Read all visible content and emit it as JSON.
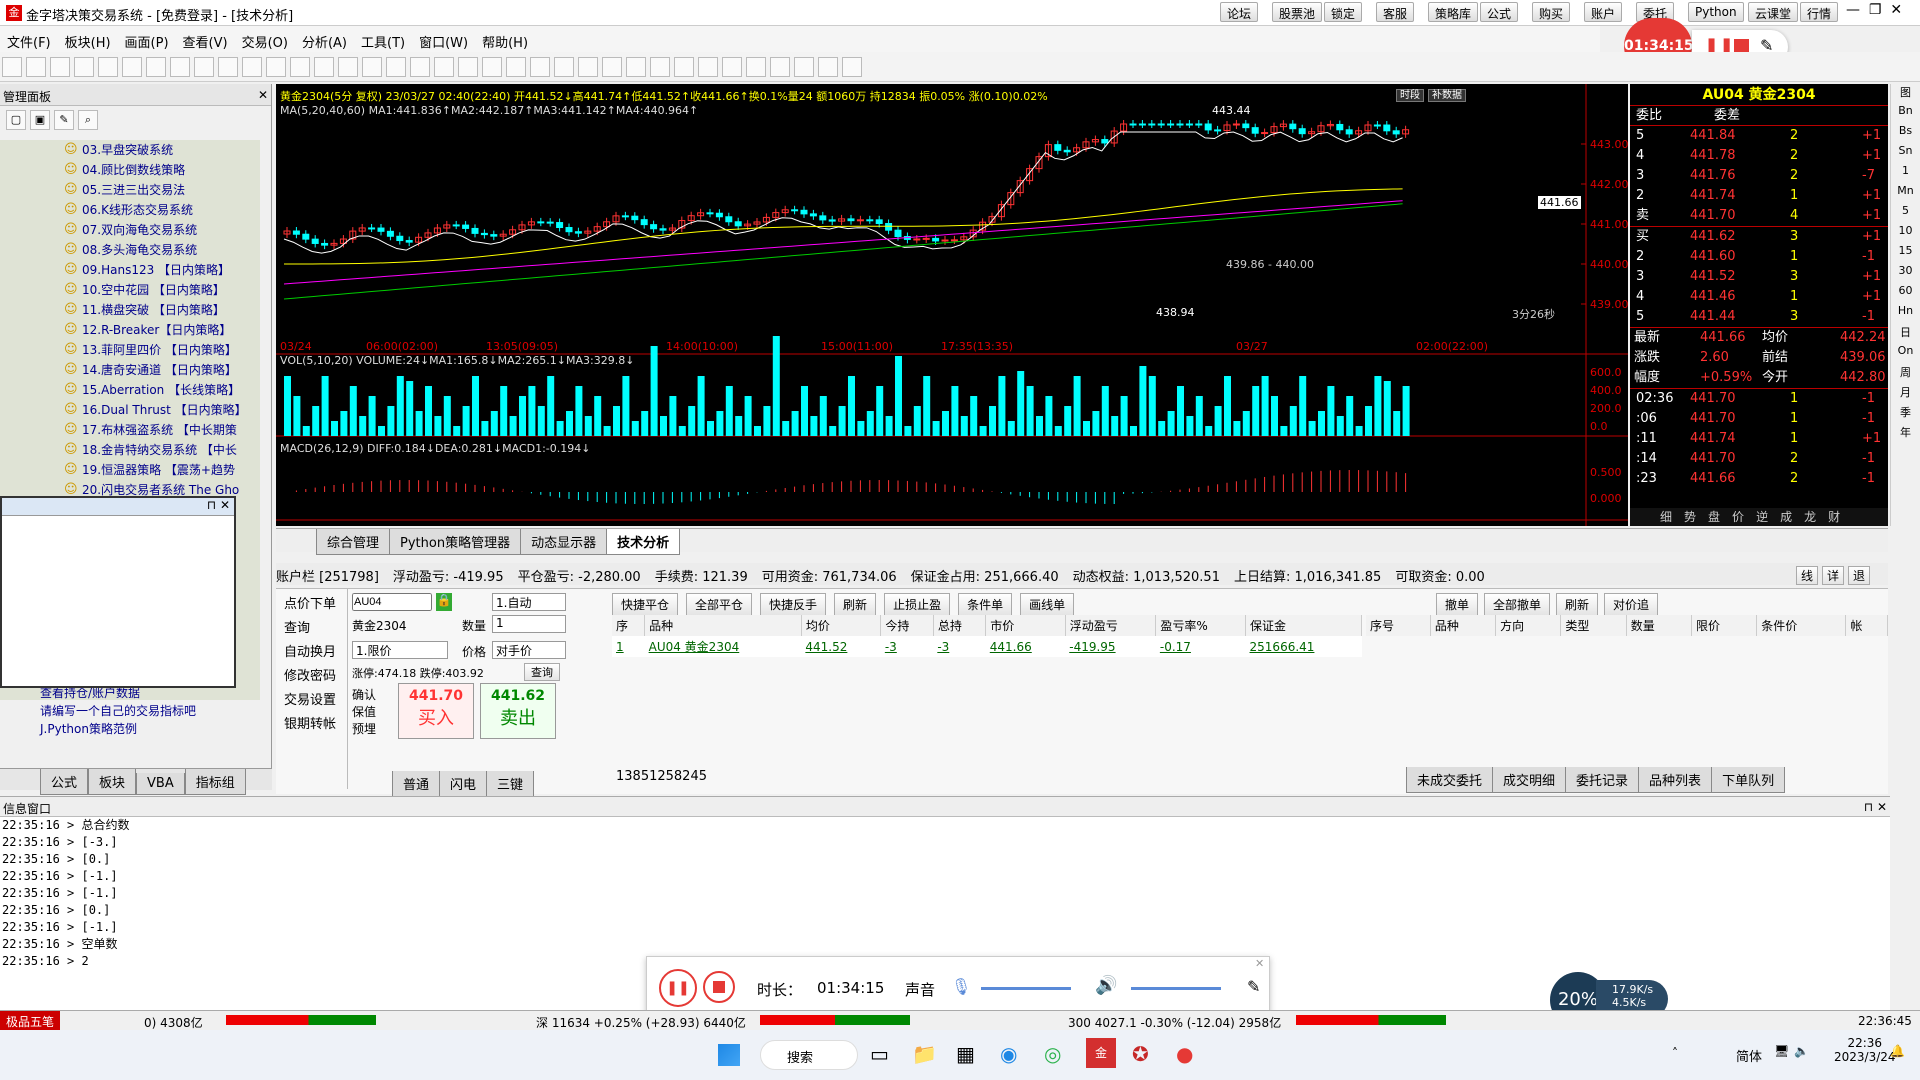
{
  "window": {
    "title": "金字塔决策交易系统 - [免费登录] - [技术分析]",
    "top_buttons": [
      "论坛",
      "股票池",
      "锁定",
      "客服",
      "策略库",
      "公式",
      "购买",
      "账户",
      "委托",
      "Python",
      "云课堂",
      "行情"
    ]
  },
  "menu": [
    "文件(F)",
    "板块(H)",
    "画面(P)",
    "查看(V)",
    "交易(O)",
    "分析(A)",
    "工具(T)",
    "窗口(W)",
    "帮助(H)"
  ],
  "recorder_badge": "01:34:15",
  "left_panel": {
    "title": "管理面板",
    "items": [
      "03.早盘突破系统",
      "04.顾比倒数线策略",
      "05.三进三出交易法",
      "06.K线形态交易系统",
      "07.双向海龟交易系统",
      "08.多头海龟交易系统",
      "09.Hans123 【日内策略】",
      "10.空中花园 【日内策略】",
      "11.横盘突破 【日内策略】",
      "12.R-Breaker【日内策略】",
      "13.菲阿里四价 【日内策略】",
      "14.唐奇安通道 【日内策略】",
      "15.Aberration 【长线策略】",
      "16.Dual Thrust 【日内策略】",
      "17.布林强盗系统 【中长期策",
      "18.金肯特纳交易系统 【中长",
      "19.恒温器策略 【震荡+趋势",
      "20.闪电交易者系统 The Gho"
    ],
    "extra_items": [
      "查看持仓/账户数据",
      "请编写一个自己的交易指标吧",
      "J.Python策略范例"
    ],
    "tabs": [
      "公式",
      "板块",
      "VBA",
      "指标组"
    ]
  },
  "chart": {
    "header": "黄金2304(5分 复权) 23/03/27 02:40(22:40) 开441.52↓高441.74↑低441.52↑收441.66↑换0.1%量24 额1060万 持12834 振0.05% 涨(0.10)0.02%",
    "ma": "MA(5,20,40,60) MA1:441.836↑MA2:442.187↑MA3:441.142↑MA4:440.964↑",
    "vol": "VOL(5,10,20) VOLUME:24↓MA1:165.8↓MA2:265.1↓MA3:329.8↓",
    "macd": "MACD(26,12,9) DIFF:0.184↓DEA:0.281↓MACD1:-0.194↓",
    "yticks": [
      "443.00",
      "442.00",
      "441.00",
      "440.00",
      "439.00"
    ],
    "time_labels": [
      "03/24",
      "06:00(02:00)",
      "13:05(09:05)",
      "14:00(10:00)",
      "15:00(11:00)",
      "17:35(13:35)",
      "03/27",
      "02:00(22:00)"
    ],
    "high_label": "443.44",
    "low_label": "438.94",
    "range_label": "439.86 - 440.00",
    "countdown": "3分26秒",
    "price_tag": "441.66",
    "vol_ticks": [
      "600.0",
      "400.0",
      "200.0",
      "0.0"
    ],
    "macd_ticks": [
      "0.500",
      "0.000"
    ],
    "tags": [
      "时段",
      "补数据"
    ]
  },
  "quote": {
    "title": "AU04 黄金2304",
    "head": [
      "委比",
      "委差"
    ],
    "sells": [
      [
        "5",
        "441.84",
        "2",
        "+1"
      ],
      [
        "4",
        "441.78",
        "2",
        "+1"
      ],
      [
        "3",
        "441.76",
        "2",
        "-7"
      ],
      [
        "2",
        "441.74",
        "1",
        "+1"
      ],
      [
        "卖",
        "441.70",
        "4",
        "+1"
      ]
    ],
    "buys": [
      [
        "买",
        "441.62",
        "3",
        "+1"
      ],
      [
        "2",
        "441.60",
        "1",
        "-1"
      ],
      [
        "3",
        "441.52",
        "3",
        "+1"
      ],
      [
        "4",
        "441.46",
        "1",
        "+1"
      ],
      [
        "5",
        "441.44",
        "3",
        "-1"
      ]
    ],
    "stats": [
      [
        "最新",
        "441.66",
        "均价",
        "442.24"
      ],
      [
        "涨跌",
        "2.60",
        "前结",
        "439.06"
      ],
      [
        "幅度",
        "+0.59%",
        "今开",
        "442.80"
      ]
    ],
    "ticks": [
      [
        "02:36",
        "441.70",
        "1",
        "-1"
      ],
      [
        ":06",
        "441.70",
        "1",
        "-1"
      ],
      [
        ":11",
        "441.74",
        "1",
        "+1"
      ],
      [
        ":14",
        "441.70",
        "2",
        "-1"
      ],
      [
        ":23",
        "441.66",
        "2",
        "-1"
      ]
    ],
    "bottom_tabs": [
      "细",
      "势",
      "盘",
      "价",
      "逆",
      "成",
      "龙",
      "财"
    ]
  },
  "right_bar": [
    "图",
    "Bn",
    "Bs",
    "Sn",
    "1",
    "Mn",
    "5",
    "10",
    "15",
    "30",
    "60",
    "Hn",
    "日",
    "On",
    "周",
    "月",
    "季",
    "年"
  ],
  "main_tabs": [
    "综合管理",
    "Python策略管理器",
    "动态显示器",
    "技术分析"
  ],
  "account": {
    "items": [
      "账户栏 [251798]",
      "浮动盈亏: -419.95",
      "平仓盈亏: -2,280.00",
      "手续费: 121.39",
      "可用资金: 761,734.06",
      "保证金占用: 251,666.40",
      "动态权益: 1,013,520.51",
      "上日结算: 1,016,341.85",
      "可取资金: 0.00"
    ],
    "tail": [
      "线",
      "详",
      "退"
    ]
  },
  "order_menu": [
    "点价下单",
    "查询",
    "自动换月",
    "修改密码",
    "交易设置",
    "银期转帐"
  ],
  "order_form": {
    "code": "AU04",
    "name": "黄金2304",
    "mode": "1.自动",
    "qty_label": "数量",
    "qty": "1",
    "type": "1.限价",
    "price_label": "价格",
    "price": "对手价",
    "limits": "涨停:474.18 跌停:403.92",
    "query": "查询",
    "checks": [
      "确认",
      "保值",
      "预埋"
    ],
    "buy_price": "441.70",
    "buy": "买入",
    "sell_price": "441.62",
    "sell": "卖出",
    "tabs": [
      "普通",
      "闪电",
      "三键"
    ]
  },
  "pos_buttons": [
    "快捷平仓",
    "全部平仓",
    "快捷反手",
    "刷新",
    "止损止盈",
    "条件单",
    "画线单"
  ],
  "pos_head": [
    "序",
    "品种",
    "均价",
    "今持",
    "总持",
    "市价",
    "浮动盈亏",
    "盈亏率%",
    "保证金"
  ],
  "pos_row": [
    "1",
    "AU04 黄金2304",
    "441.52",
    "-3",
    "-3",
    "441.66",
    "-419.95",
    "-0.17",
    "251666.41"
  ],
  "phone": "13851258245",
  "ord_buttons": [
    "撤单",
    "全部撤单",
    "刷新",
    "对价追"
  ],
  "ord_head": [
    "序号",
    "品种",
    "方向",
    "类型",
    "数量",
    "限价",
    "条件价",
    "帐"
  ],
  "ord_tabs": [
    "未成交委托",
    "成交明细",
    "委托记录",
    "品种列表",
    "下单队列"
  ],
  "info": {
    "title": "信息窗口",
    "lines": [
      "22:35:16 > 总合约数",
      "22:35:16 > [-3.]",
      "22:35:16 > [0.]",
      "22:35:16 > [-1.]",
      "22:35:16 > [-1.]",
      "22:35:16 > [0.]",
      "22:35:16 > [-1.]",
      "22:35:16 > 空单数",
      "22:35:16 > 2"
    ]
  },
  "recorder": {
    "duration_label": "时长：",
    "duration": "01:34:15",
    "sound": "声音"
  },
  "net": {
    "pct": "20%",
    "up": "17.9K/s",
    "down": "4.5K/s"
  },
  "status": {
    "ime": "极品五笔",
    "left": "0) 4308亿",
    "sz": "深 11634 +0.25% (+28.93) 6440亿",
    "hs": "300 4027.1 -0.30% (-12.04) 2958亿",
    "time": "22:36:45"
  },
  "taskbar": {
    "search": "搜索",
    "lang": "简体",
    "clock": "22:36",
    "date": "2023/3/24"
  }
}
